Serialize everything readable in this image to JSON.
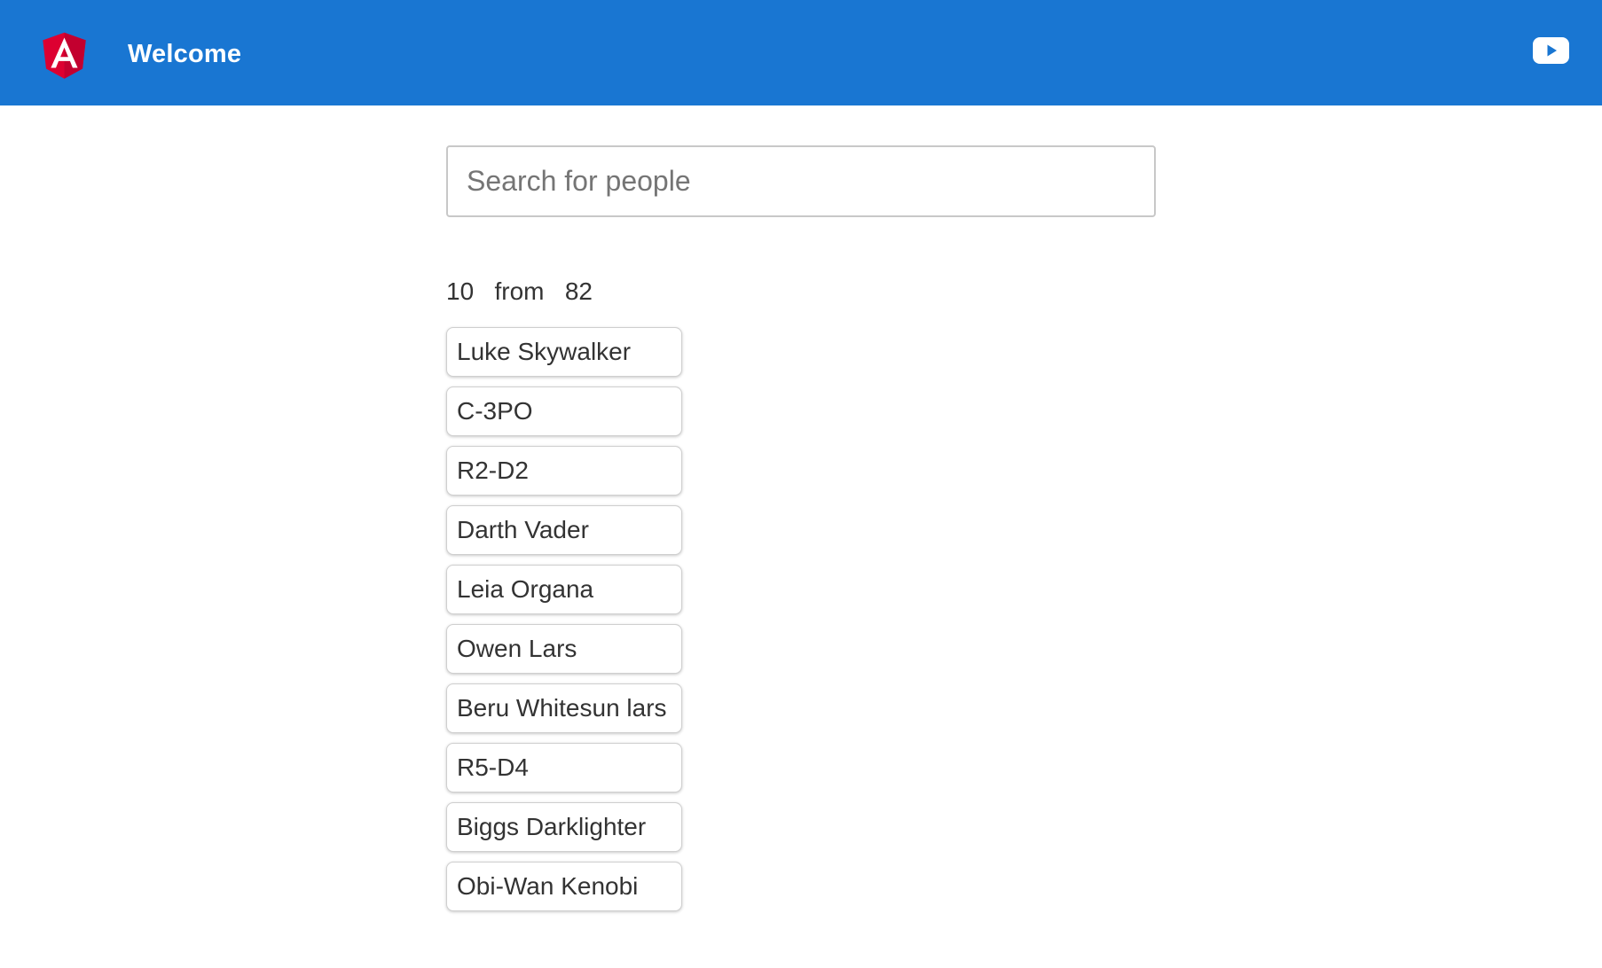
{
  "header": {
    "title": "Welcome",
    "logo_icon": "angular-logo-icon",
    "youtube_icon": "youtube-icon",
    "background_color": "#1976d2"
  },
  "search": {
    "placeholder": "Search for people",
    "value": ""
  },
  "results": {
    "shown": "10",
    "separator": "from",
    "total": "82"
  },
  "people": [
    "Luke Skywalker",
    "C-3PO",
    "R2-D2",
    "Darth Vader",
    "Leia Organa",
    "Owen Lars",
    "Beru Whitesun lars",
    "R5-D4",
    "Biggs Darklighter",
    "Obi-Wan Kenobi"
  ],
  "colors": {
    "accent": "#1976d2",
    "logo_red": "#dd0031",
    "logo_dark_red": "#c3002f"
  }
}
